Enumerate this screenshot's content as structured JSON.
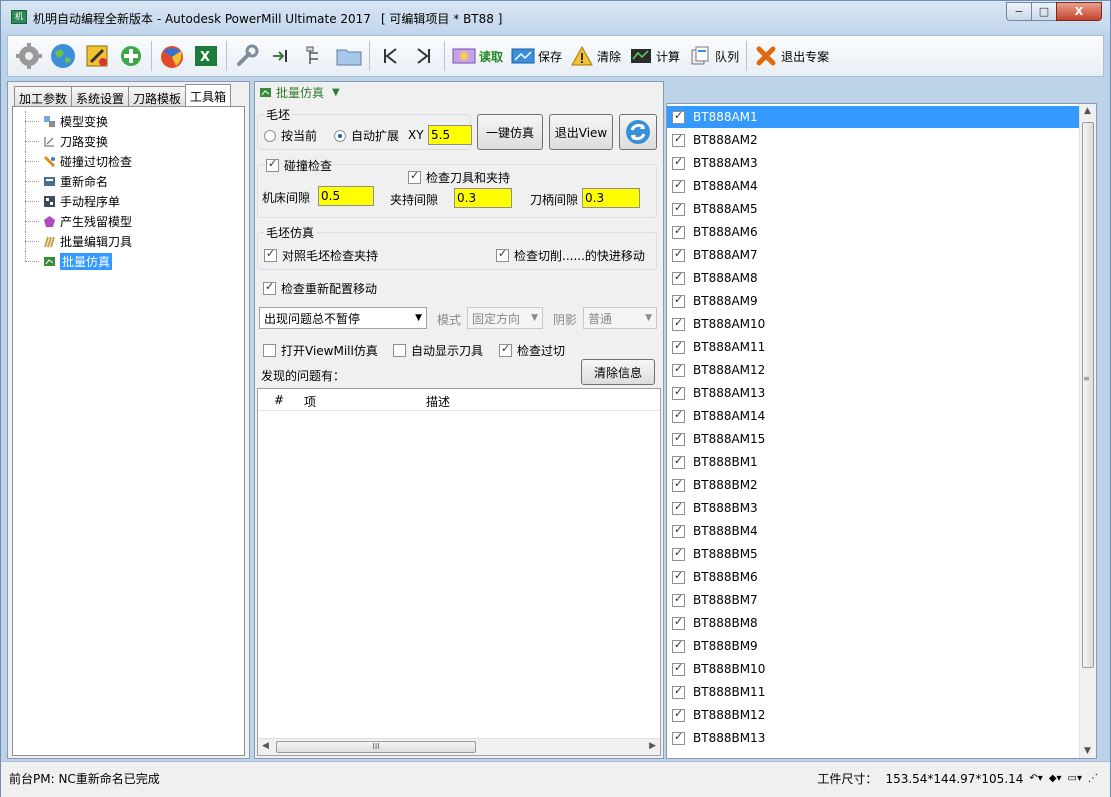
{
  "window": {
    "title": "机明自动编程全新版本 - Autodesk PowerMill Ultimate 2017",
    "project": "[ 可编辑项目 * BT88 ]",
    "minimize_glyph": "−",
    "maximize_glyph": "□",
    "close_glyph": "X"
  },
  "toolbar": {
    "read_label": "读取",
    "save_label": "保存",
    "clear_label": "清除",
    "calc_label": "计算",
    "queue_label": "队列",
    "exit_label": "退出专案"
  },
  "left_panel": {
    "tabs": [
      "加工参数",
      "系统设置",
      "刀路模板",
      "工具箱"
    ],
    "tree": [
      {
        "label": "模型变换",
        "icon": "model-transform-icon"
      },
      {
        "label": "刀路变换",
        "icon": "toolpath-transform-icon"
      },
      {
        "label": "碰撞过切检查",
        "icon": "collision-check-icon"
      },
      {
        "label": "重新命名",
        "icon": "rename-icon"
      },
      {
        "label": "手动程序单",
        "icon": "manual-sheet-icon"
      },
      {
        "label": "产生残留模型",
        "icon": "stock-model-icon"
      },
      {
        "label": "批量编辑刀具",
        "icon": "batch-tool-icon"
      },
      {
        "label": "批量仿真",
        "icon": "batch-sim-icon"
      }
    ]
  },
  "center": {
    "header": "批量仿真",
    "blank_group": "毛坯",
    "radio_current": "按当前",
    "radio_auto": "自动扩展",
    "xy_label": "XY",
    "xy_value": "5.5",
    "one_key_sim": "一键仿真",
    "exit_view": "退出View",
    "collision_group": "碰撞检查",
    "check_tool_holder": "检查刀具和夹持",
    "machine_gap_label": "机床间隙",
    "machine_gap_value": "0.5",
    "holder_gap_label": "夹持间隙",
    "holder_gap_value": "0.3",
    "shank_gap_label": "刀柄间隙",
    "shank_gap_value": "0.3",
    "stock_sim_group": "毛坯仿真",
    "check_holder_vs_blank": "对照毛坯检查夹持",
    "check_rapid_moves": "检查切削......的快进移动",
    "check_reconfig": "检查重新配置移动",
    "pause_option": "出现问题总不暂停",
    "mode_label": "模式",
    "mode_value": "固定方向",
    "shade_label": "阴影",
    "shade_value": "普通",
    "open_viewmill": "打开ViewMill仿真",
    "auto_show_tool": "自动显示刀具",
    "check_gouge": "检查过切",
    "found_problems": "发现的问题有：",
    "clear_info": "清除信息",
    "table_headers": [
      "#",
      "项",
      "描述"
    ],
    "hscroll_grip": "III"
  },
  "right_list": {
    "items": [
      "BT888AM1",
      "BT888AM2",
      "BT888AM3",
      "BT888AM4",
      "BT888AM5",
      "BT888AM6",
      "BT888AM7",
      "BT888AM8",
      "BT888AM9",
      "BT888AM10",
      "BT888AM11",
      "BT888AM12",
      "BT888AM13",
      "BT888AM14",
      "BT888AM15",
      "BT888BM1",
      "BT888BM2",
      "BT888BM3",
      "BT888BM4",
      "BT888BM5",
      "BT888BM6",
      "BT888BM7",
      "BT888BM8",
      "BT888BM9",
      "BT888BM10",
      "BT888BM11",
      "BT888BM12",
      "BT888BM13"
    ],
    "selected_index": 0,
    "scroll_grip": "≡"
  },
  "status": {
    "left": "前台PM: NC重新命名已完成",
    "size_label": "工件尺寸：",
    "size_value": "153.54*144.97*105.14"
  },
  "colors": {
    "selection": "#3399ff",
    "input_highlight": "#ffff00",
    "accent_green": "#2e7d32"
  }
}
